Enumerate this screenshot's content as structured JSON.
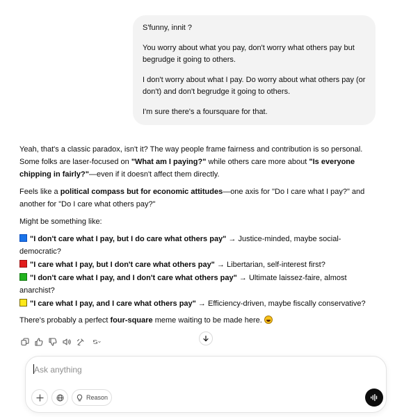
{
  "user_message": {
    "paragraphs": [
      "S'funny, innit ?",
      "You worry about what you pay, don't worry what others pay but begrudge it going to others.",
      "I don't worry about what I pay. Do worry about what others pay (or don't) and don't begrudge it going to others.",
      "I'm sure there's a foursquare for that."
    ]
  },
  "assistant": {
    "p1_a": "Yeah, that's a classic paradox, isn't it? The way people frame fairness and contribution is so personal. Some folks are laser-focused on ",
    "p1_b1": "\"What am I paying?\"",
    "p1_c": " while others care more about ",
    "p1_b2": "\"Is everyone chipping in fairly?\"",
    "p1_d": "—even if it doesn't affect them directly.",
    "p2_a": "Feels like a ",
    "p2_b": "political compass but for economic attitudes",
    "p2_c": "—one axis for \"Do I care what I pay?\" and another for \"Do I care what others pay?\"",
    "p3": "Might be something like:",
    "items": [
      {
        "color": "blue",
        "bold": "\"I don't care what I pay, but I do care what others pay\"",
        "rest": " → Justice-minded, maybe social-democratic?"
      },
      {
        "color": "red",
        "bold": "\"I care what I pay, but I don't care what others pay\"",
        "rest": " → Libertarian, self-interest first?"
      },
      {
        "color": "green",
        "bold": "\"I don't care what I pay, and I don't care what others pay\"",
        "rest": " → Ultimate laissez-faire, almost anarchist?"
      },
      {
        "color": "yellow",
        "bold": "\"I care what I pay, and I care what others pay\"",
        "rest": " → Efficiency-driven, maybe fiscally conservative?"
      }
    ],
    "p4_a": "There's probably a perfect ",
    "p4_b": "four-square",
    "p4_c": " meme waiting to be made here. "
  },
  "actions": [
    "copy-icon",
    "thumbs-up-icon",
    "thumbs-down-icon",
    "read-aloud-icon",
    "edit-icon",
    "regenerate-icon"
  ],
  "composer": {
    "placeholder": "Ask anything",
    "reason_label": "Reason"
  },
  "colors": {
    "accent": "#0d0d0d",
    "bubble": "#f3f3f3",
    "blue": "#1a73e8",
    "red": "#e11d1d",
    "green": "#22b31f",
    "yellow": "#ffe81a"
  }
}
